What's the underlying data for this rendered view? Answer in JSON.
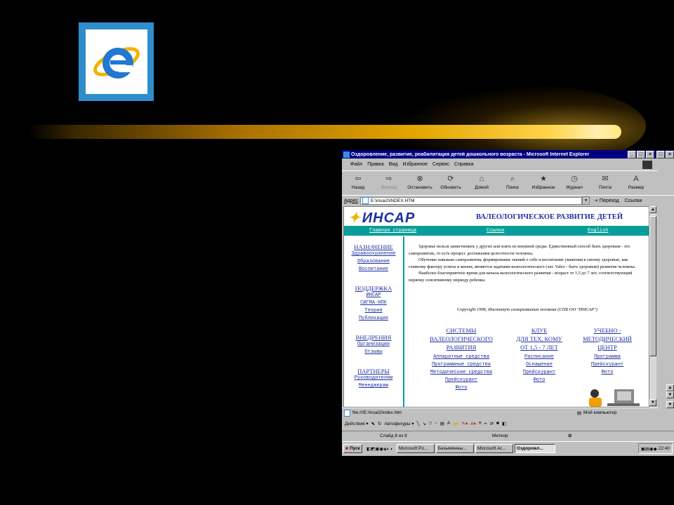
{
  "window": {
    "title": "Оздоровление, развитие, реабилитация детей дошкольного возраста - Microsoft Internet Explorer",
    "controls": [
      "_",
      "□",
      "×"
    ]
  },
  "menu": [
    "Файл",
    "Правка",
    "Вид",
    "Избранное",
    "Сервис",
    "Справка"
  ],
  "toolbar": [
    {
      "label": "Назад",
      "icon": "back-arrow-icon",
      "glyph": "⇦"
    },
    {
      "label": "Вперед",
      "icon": "forward-arrow-icon",
      "glyph": "⇨",
      "disabled": true
    },
    {
      "label": "Остановить",
      "icon": "stop-icon",
      "glyph": "⊗"
    },
    {
      "label": "Обновить",
      "icon": "refresh-icon",
      "glyph": "⟳"
    },
    {
      "label": "Домой",
      "icon": "home-icon",
      "glyph": "⌂"
    },
    {
      "label": "Поиск",
      "icon": "search-icon",
      "glyph": "⌕"
    },
    {
      "label": "Избранное",
      "icon": "favorites-icon",
      "glyph": "★"
    },
    {
      "label": "Журнал",
      "icon": "history-icon",
      "glyph": "◷"
    },
    {
      "label": "Почта",
      "icon": "mail-icon",
      "glyph": "✉"
    },
    {
      "label": "Размер",
      "icon": "font-size-icon",
      "glyph": "A"
    }
  ],
  "address": {
    "label": "Адрес",
    "value": "E:\\insai2\\INDEX.HTM",
    "go": "Переход",
    "links": "Ссылки"
  },
  "page": {
    "logo": "ИНСАР",
    "banner_title": "ВАЛЕОЛОГИЧЕСКОЕ РАЗВИТИЕ ДЕТЕЙ",
    "nav": [
      "Главная страница",
      "Ссылки",
      "English"
    ],
    "sidebar": [
      {
        "heading": "НАЗНАЧЕНИЕ",
        "links": [
          "Здравоохранение",
          "Образование",
          "Воспитание"
        ]
      },
      {
        "heading": "ПОДДЕРЖКА",
        "links": [
          "ИНСАР",
          "СИГМА-НПК",
          "Теория",
          "Публикации"
        ]
      },
      {
        "heading": "ВНЕДРЕНИЯ",
        "links": [
          "Организации",
          "Отзывы"
        ]
      },
      {
        "heading": "ПАРТНЕРЫ",
        "links": [
          "Руководителям",
          "Менеджерам"
        ]
      }
    ],
    "paragraphs": [
      "Здоровье нельзя заимствовать у других или взять из внешней среды. Единственный способ быть здоровым - это саморазвитие, то есть процесс достижения целостности человека.",
      "Обучение навыкам саморазвития, формирование знаний о себе и воспитание уважения к своему здоровью, как главному фактору успеха в жизни, являются задачами валеологического (лат. Valeo - быть здоровым) развития человека.",
      "Наиболее благоприятное время для начала валеологического развития - возраст от 1,5 до 7 лет, соответствующий первому сенситивному периоду ребенка."
    ],
    "copyright": "Copyright 1996, Институт саморазвития человека (СПБ ОО \"ИНСАР\")",
    "columns": [
      {
        "heading": [
          "СИСТЕМЫ",
          "ВАЛЕОЛОГИЧЕСКОГО",
          "РАЗВИТИЯ"
        ],
        "links": [
          "Аппаратные средства",
          "Программные средства",
          "Методические средства",
          "Прейскурант",
          "Фото"
        ]
      },
      {
        "heading": [
          "КЛУБ",
          "ДЛЯ ТЕХ, КОМУ",
          "ОТ 1,5 - 7 ЛЕТ"
        ],
        "links": [
          "Расписание",
          "Оснащение",
          "Прейскурант",
          "Фото"
        ]
      },
      {
        "heading": [
          "УЧЕБНО -",
          "МЕТОДИЧЕСКИЙ",
          "ЦЕНТР"
        ],
        "links": [
          "Программа",
          "Прейскурант",
          "Фото"
        ]
      }
    ]
  },
  "status": {
    "url": "file:///E:/insai2/index.htm",
    "zone": "Мой компьютер"
  },
  "drawbar": {
    "actions": "Действия",
    "autoshapes": "Автофигуры"
  },
  "slidebar": {
    "slide": "Слайд 8 из 8",
    "design": "Метеор"
  },
  "taskbar": {
    "start": "Пуск",
    "buttons": [
      "Microsoft Po...",
      "Безымянны...",
      "Microsoft Ac...",
      "Оздоровл..."
    ],
    "active_index": 3,
    "time": "22:40"
  }
}
